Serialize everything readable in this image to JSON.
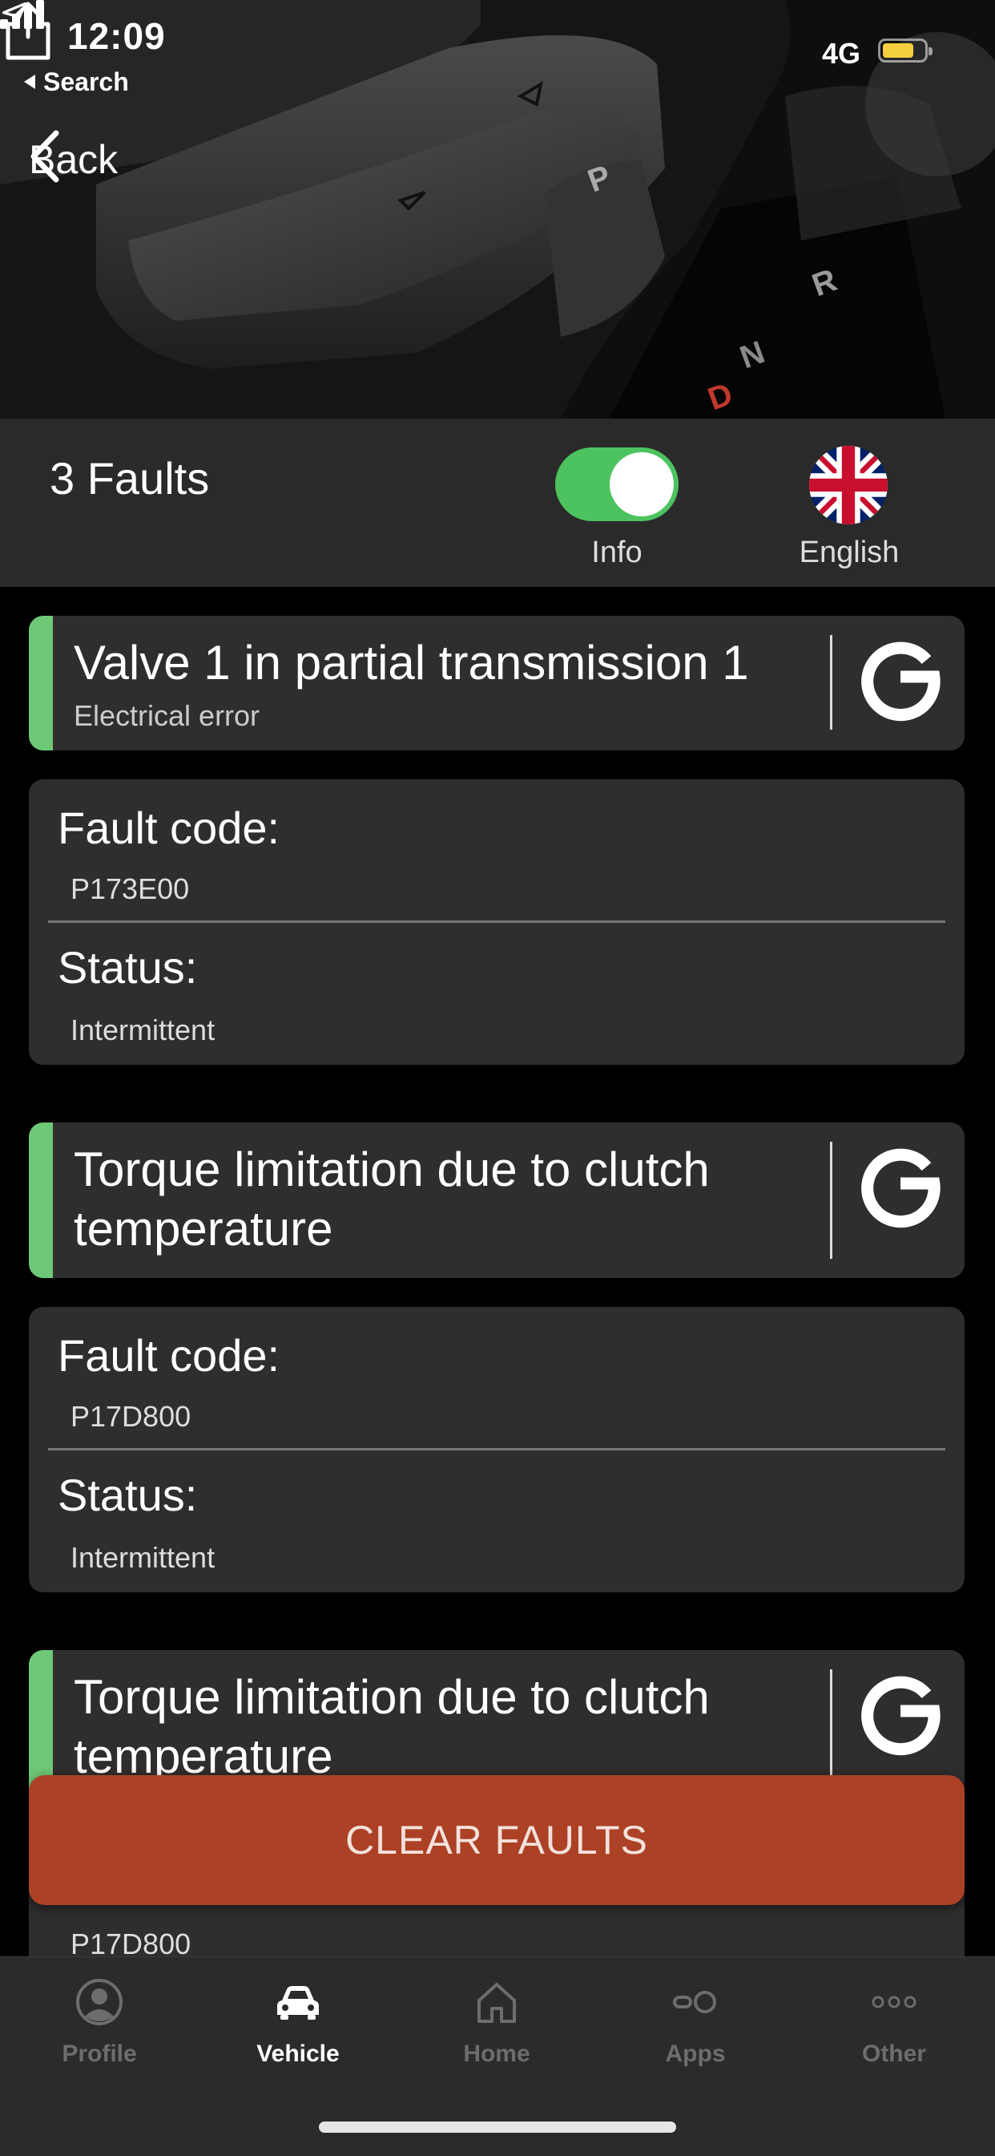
{
  "status_bar": {
    "time": "12:09",
    "back_app": "Search",
    "network": "4G",
    "battery_color": "#f4d03f"
  },
  "nav": {
    "back_label": "Back"
  },
  "header": {
    "faults_count_label": "3 Faults",
    "info_toggle_label": "Info",
    "info_toggle_on": true,
    "language_label": "English"
  },
  "faults": [
    {
      "title": "Valve 1 in partial transmission 1",
      "subtitle": "Electrical error",
      "fault_code_label": "Fault code:",
      "fault_code": "P173E00",
      "status_label": "Status:",
      "status": "Intermittent"
    },
    {
      "title": "Torque limitation due to clutch temperature",
      "fault_code_label": "Fault code:",
      "fault_code": "P17D800",
      "status_label": "Status:",
      "status": "Intermittent"
    },
    {
      "title": "Torque limitation due to clutch temperature",
      "fault_code": "P17D800"
    }
  ],
  "actions": {
    "clear_faults": "CLEAR FAULTS"
  },
  "tab_bar": {
    "items": [
      {
        "label": "Profile",
        "icon": "profile-icon"
      },
      {
        "label": "Vehicle",
        "icon": "car-icon",
        "active": true
      },
      {
        "label": "Home",
        "icon": "home-icon"
      },
      {
        "label": "Apps",
        "icon": "apps-icon"
      },
      {
        "label": "Other",
        "icon": "more-icon"
      }
    ]
  },
  "colors": {
    "accent_green": "#6fc878",
    "toggle_green": "#4cc35e",
    "clear_button": "#ac4126",
    "card_bg": "#2e2e2e"
  }
}
